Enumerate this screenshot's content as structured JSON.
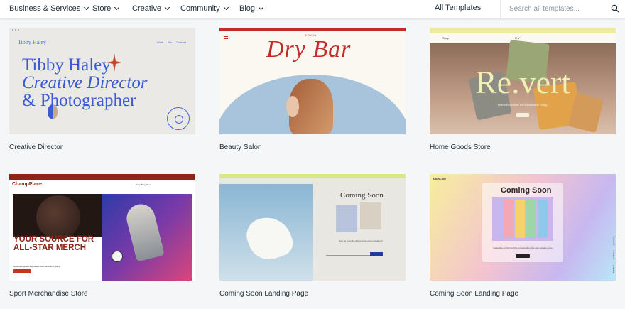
{
  "nav": {
    "items": [
      {
        "label": "Business & Services"
      },
      {
        "label": "Store"
      },
      {
        "label": "Creative"
      },
      {
        "label": "Community"
      },
      {
        "label": "Blog"
      }
    ],
    "all_templates": "All Templates",
    "search_placeholder": "Search all templates..."
  },
  "cards": [
    {
      "title": "Creative Director",
      "preview": {
        "brand": "Tibby Haley",
        "nav": [
          "Work",
          "Bio",
          "Contact"
        ],
        "hero_line1": "Tibby Haley",
        "hero_line2": "Creative Director",
        "hero_line3": "& Photographer"
      }
    },
    {
      "title": "Beauty Salon",
      "preview": {
        "logo": "SOVIN",
        "hero": "Dry Bar"
      }
    },
    {
      "title": "Home Goods Store",
      "preview": {
        "nav_left": "Shop",
        "nav_center": "R.V",
        "hero": "Re.vert",
        "tagline": "Home Essentials for Sustainable Living",
        "button": "Shop Now"
      }
    },
    {
      "title": "Sport Merchandise Store",
      "preview": {
        "logo": "ChampPlace.",
        "nav": "Shop   Blog   About",
        "hero": "YOUR SOURCE FOR ALL-STAR MERCH",
        "sub": "Courtside goods that keeps the momentum going",
        "button": "SHOP NOW"
      }
    },
    {
      "title": "Coming Soon Landing Page",
      "preview": {
        "hero": "Coming Soon",
        "sub": "Sign up to be the first to know when we launch"
      }
    },
    {
      "title": "Coming Soon Landing Page",
      "preview": {
        "logo": "Allura.Set",
        "hero": "Coming Soon",
        "sub": "Subscribe and be the first to know when the new arrivals arrive",
        "button": "Subscribe",
        "side_labels": [
          "Facebook",
          "Instagram",
          "Pinterest"
        ]
      }
    }
  ],
  "colors": {
    "page_bg": "#f5f6f7",
    "text": "#20303c",
    "tibby_blue": "#3a5ad6",
    "drybar_red": "#c42a2a",
    "revert_yellow": "#f0efb4",
    "champ_red": "#8c2418"
  },
  "icons": {
    "search": "search-icon",
    "chevron": "chevron-down-icon"
  }
}
